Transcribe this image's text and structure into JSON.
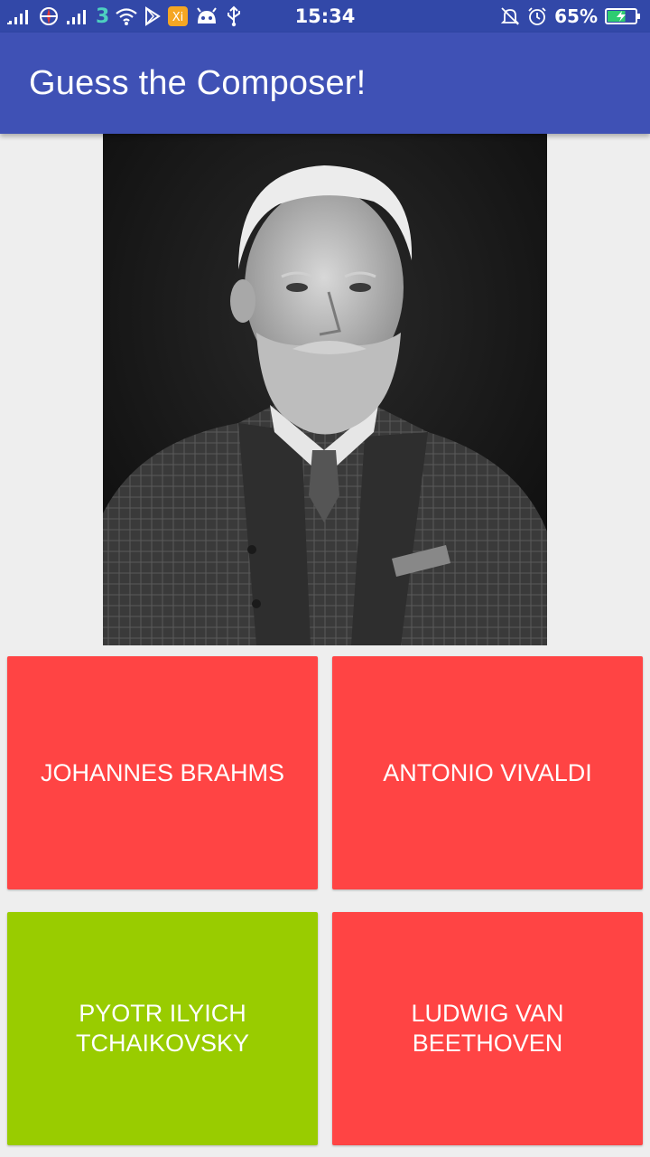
{
  "status_bar": {
    "time": "15:34",
    "battery_percent": "65%",
    "battery_level": 0.65,
    "left_icons": [
      "signal-icon",
      "maps-icon",
      "signal-icon",
      "network-3-icon",
      "wifi-icon",
      "play-store-icon",
      "xiaomi-app-icon",
      "android-icon",
      "usb-icon"
    ],
    "right_icons": [
      "mute-bell-icon",
      "alarm-icon",
      "battery-charging-icon"
    ]
  },
  "toolbar": {
    "title": "Guess the Composer!",
    "color": "#3f51b5"
  },
  "portrait": {
    "alt": "composer-portrait"
  },
  "answers": [
    {
      "label": "JOHANNES BRAHMS",
      "state": "wrong",
      "color": "#ff4444"
    },
    {
      "label": "ANTONIO VIVALDI",
      "state": "wrong",
      "color": "#ff4444"
    },
    {
      "label": "PYOTR ILYICH TCHAIKOVSKY",
      "state": "correct",
      "color": "#99cc00"
    },
    {
      "label": "LUDWIG VAN BEETHOVEN",
      "state": "wrong",
      "color": "#ff4444"
    }
  ]
}
